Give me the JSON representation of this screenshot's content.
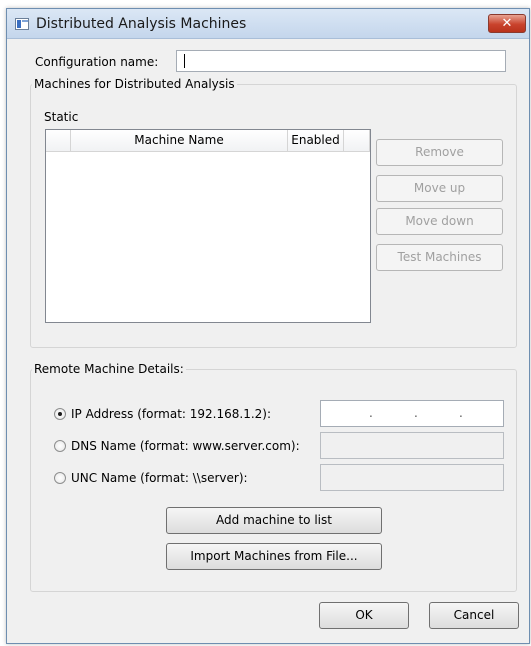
{
  "window": {
    "title": "Distributed Analysis Machines",
    "close_label": "✕"
  },
  "config": {
    "label": "Configuration name:",
    "value": ""
  },
  "machines_group": {
    "legend": "Machines for Distributed Analysis",
    "static_label": "Static",
    "columns": [
      "",
      "Machine Name",
      "Enabled",
      ""
    ],
    "rows": []
  },
  "side_buttons": {
    "remove": "Remove",
    "move_up": "Move up",
    "move_down": "Move down",
    "test": "Test Machines"
  },
  "remote_group": {
    "legend": "Remote Machine Details:",
    "ip_label": "IP Address (format: 192.168.1.2):",
    "dns_label": "DNS Name (format: www.server.com):",
    "unc_label": "UNC Name (format: \\\\server):",
    "selected": "ip",
    "ip_separators": [
      ".",
      ".",
      "."
    ]
  },
  "actions": {
    "add": "Add machine to list",
    "import": "Import Machines from File..."
  },
  "footer": {
    "ok": "OK",
    "cancel": "Cancel"
  }
}
